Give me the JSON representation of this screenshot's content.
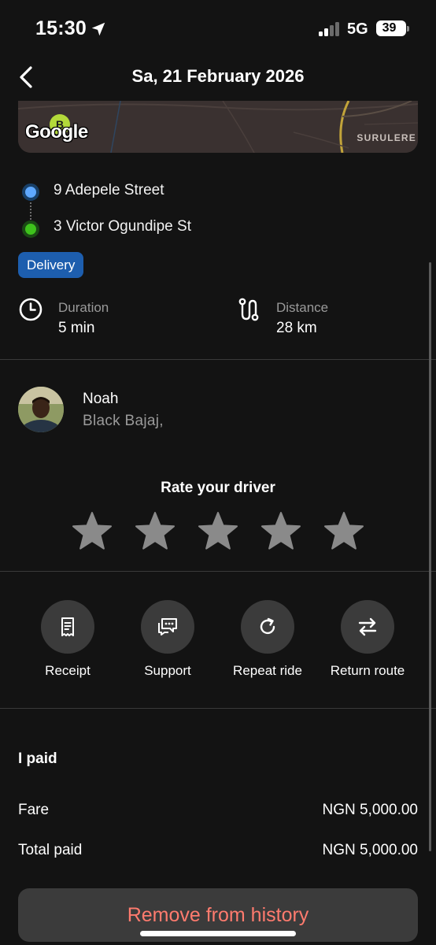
{
  "status_bar": {
    "time": "15:30",
    "network": "5G",
    "battery": "39",
    "icons": [
      "location-arrow-icon",
      "signal-icon",
      "battery-icon"
    ]
  },
  "header": {
    "title": "Sa, 21 February 2026",
    "back_icon": "chevron-left-icon"
  },
  "map": {
    "logo": "Google",
    "pin_label": "B",
    "area_label": "SURULERE"
  },
  "route": {
    "pickup": "9 Adepele Street",
    "dropoff": "3 Victor Ogundipe St",
    "pickup_color": "#5fa8ff",
    "dropoff_color": "#3ec21c"
  },
  "badge": {
    "label": "Delivery",
    "color": "#1d5eae"
  },
  "stats": {
    "duration_label": "Duration",
    "duration_value": "5 min",
    "distance_label": "Distance",
    "distance_value": "28 km",
    "duration_icon": "clock-icon",
    "distance_icon": "route-icon"
  },
  "driver": {
    "name": "Noah",
    "vehicle": "Black  Bajaj,"
  },
  "rating": {
    "title": "Rate your driver",
    "max_stars": 5,
    "selected": 0
  },
  "actions": [
    {
      "label": "Receipt",
      "icon": "receipt-icon"
    },
    {
      "label": "Support",
      "icon": "chat-icon"
    },
    {
      "label": "Repeat ride",
      "icon": "refresh-icon"
    },
    {
      "label": "Return route",
      "icon": "swap-arrows-icon"
    }
  ],
  "payment": {
    "title": "I paid",
    "rows": [
      {
        "label": "Fare",
        "value": "NGN 5,000.00"
      },
      {
        "label": "Total paid",
        "value": "NGN 5,000.00"
      }
    ]
  },
  "remove_button": {
    "label": "Remove from history",
    "color": "#ff7b6e"
  }
}
